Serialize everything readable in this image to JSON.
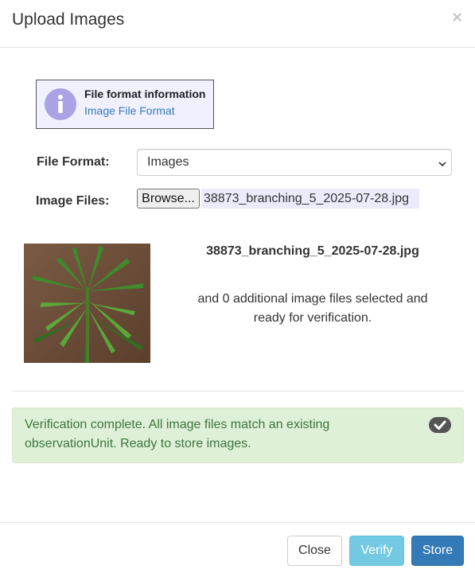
{
  "modal": {
    "title": "Upload Images",
    "close_glyph": "×"
  },
  "info": {
    "icon": "info-icon",
    "title": "File format information",
    "link_text": "Image File Format"
  },
  "form": {
    "format_label": "File Format:",
    "format_value": "Images",
    "files_label": "Image Files:",
    "browse_label": "Browse...",
    "selected_file": "38873_branching_5_2025-07-28.jpg"
  },
  "preview": {
    "file_name": "38873_branching_5_2025-07-28.jpg",
    "note": "and 0 additional image files selected and ready for verification."
  },
  "alert": {
    "message": "Verification complete. All image files match an existing observationUnit. Ready to store images.",
    "icon": "check-circle-icon",
    "color": "#3c763d",
    "background": "#dff0d8"
  },
  "footer": {
    "close_label": "Close",
    "verify_label": "Verify",
    "store_label": "Store"
  },
  "colors": {
    "primary": "#337ab7",
    "info": "#5bc0de",
    "info_box_bg": "#f0f0ff"
  }
}
